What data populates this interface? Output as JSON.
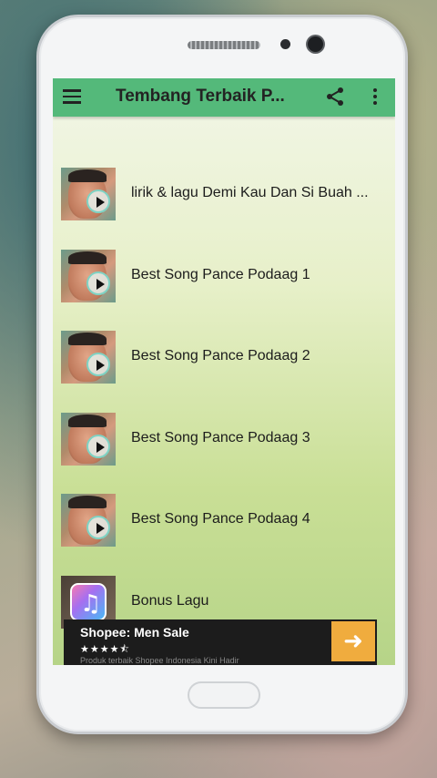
{
  "appbar": {
    "title": "Tembang Terbaik P...",
    "menu_icon": "hamburger-menu-icon",
    "share_icon": "share-icon",
    "more_icon": "more-vert-icon"
  },
  "list": {
    "items": [
      {
        "label": "lirik & lagu Demi Kau Dan Si Buah ...",
        "thumb": "singer-play-thumbnail"
      },
      {
        "label": "Best Song Pance Podaag 1",
        "thumb": "singer-play-thumbnail"
      },
      {
        "label": "Best Song Pance Podaag 2",
        "thumb": "singer-play-thumbnail"
      },
      {
        "label": "Best Song Pance Podaag 3",
        "thumb": "singer-play-thumbnail"
      },
      {
        "label": "Best Song Pance Podaag 4",
        "thumb": "singer-play-thumbnail"
      },
      {
        "label": "Bonus Lagu",
        "thumb": "music-app-icon"
      }
    ]
  },
  "ad": {
    "title": "Shopee: Men Sale",
    "stars": "★★★★⯪",
    "subtitle": "Produk terbaik Shopee Indonesia Kini Hadir",
    "cta_icon": "arrow-right-icon"
  }
}
